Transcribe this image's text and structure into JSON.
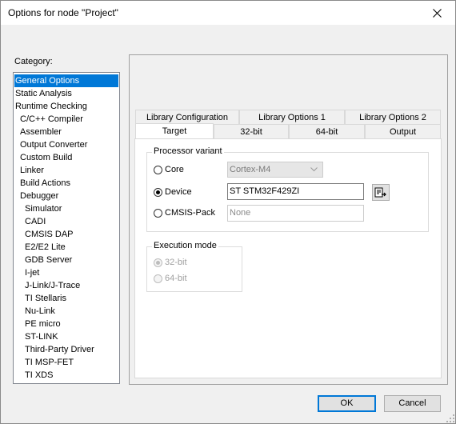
{
  "window": {
    "title": "Options for node \"Project\"",
    "close_icon": "close-icon"
  },
  "category": {
    "label": "Category:",
    "items": [
      {
        "label": "General Options",
        "selected": true
      },
      {
        "label": "Static Analysis"
      },
      {
        "label": "Runtime Checking"
      },
      {
        "label": "C/C++ Compiler"
      },
      {
        "label": "Assembler"
      },
      {
        "label": "Output Converter"
      },
      {
        "label": "Custom Build"
      },
      {
        "label": "Linker"
      },
      {
        "label": "Build Actions"
      },
      {
        "label": "Debugger"
      },
      {
        "label": "Simulator"
      },
      {
        "label": "CADI"
      },
      {
        "label": "CMSIS DAP"
      },
      {
        "label": "E2/E2 Lite"
      },
      {
        "label": "GDB Server"
      },
      {
        "label": "I-jet"
      },
      {
        "label": "J-Link/J-Trace"
      },
      {
        "label": "TI Stellaris"
      },
      {
        "label": "Nu-Link"
      },
      {
        "label": "PE micro"
      },
      {
        "label": "ST-LINK"
      },
      {
        "label": "Third-Party Driver"
      },
      {
        "label": "TI MSP-FET"
      },
      {
        "label": "TI XDS"
      }
    ]
  },
  "tabs": {
    "row1": [
      "Library Configuration",
      "Library Options 1",
      "Library Options 2"
    ],
    "row2": [
      "Target",
      "32-bit",
      "64-bit",
      "Output"
    ],
    "active": "Target"
  },
  "processor_variant": {
    "title": "Processor variant",
    "core_label": "Core",
    "core_value": "Cortex-M4",
    "device_label": "Device",
    "device_value": "ST STM32F429ZI",
    "browse_icon": "device-select-icon",
    "cmsis_label": "CMSIS-Pack",
    "cmsis_placeholder": "None",
    "selected": "Device"
  },
  "execution_mode": {
    "title": "Execution mode",
    "opt_32": "32-bit",
    "opt_64": "64-bit",
    "selected": "32-bit"
  },
  "buttons": {
    "ok": "OK",
    "cancel": "Cancel"
  },
  "colors": {
    "selection": "#0078d7",
    "default_button_border": "#0078d7"
  }
}
